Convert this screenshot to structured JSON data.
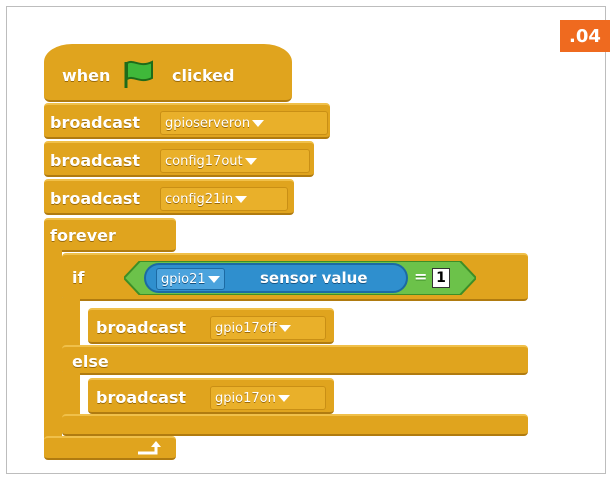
{
  "badge": ".04",
  "hat": {
    "when": "when",
    "clicked": "clicked",
    "flag_icon": "green-flag-icon"
  },
  "broadcasts": [
    {
      "label": "broadcast",
      "message": "gpioserveron"
    },
    {
      "label": "broadcast",
      "message": "config17out"
    },
    {
      "label": "broadcast",
      "message": "config21in"
    }
  ],
  "forever": {
    "label": "forever"
  },
  "if_block": {
    "if_label": "if",
    "sensor": {
      "dropdown": "gpio21",
      "label": "sensor value"
    },
    "op": "=",
    "value": "1",
    "then": {
      "label": "broadcast",
      "message": "gpio17off"
    },
    "else_label": "else",
    "else": {
      "label": "broadcast",
      "message": "gpio17on"
    }
  },
  "colors": {
    "control": "#e0a41e",
    "sensing": "#2f8fce",
    "operator": "#6cc24a",
    "badge": "#ef6a1f"
  }
}
